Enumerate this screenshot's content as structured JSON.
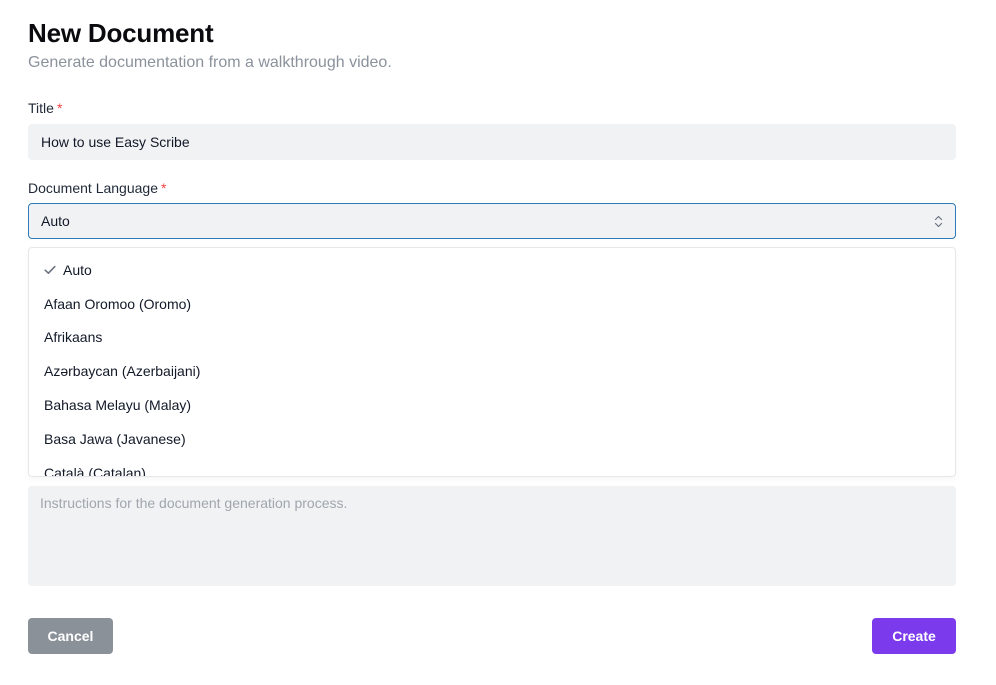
{
  "header": {
    "title": "New Document",
    "subtitle": "Generate documentation from a walkthrough video."
  },
  "form": {
    "title_field": {
      "label": "Title",
      "required_mark": "*",
      "value": "How to use Easy Scribe"
    },
    "language_field": {
      "label": "Document Language",
      "required_mark": "*",
      "selected": "Auto",
      "options": [
        "Auto",
        "Afaan Oromoo (Oromo)",
        "Afrikaans",
        "Azərbaycan (Azerbaijani)",
        "Bahasa Melayu (Malay)",
        "Basa Jawa (Javanese)",
        "Català (Catalan)"
      ]
    },
    "instructions_field": {
      "placeholder": "Instructions for the document generation process."
    }
  },
  "actions": {
    "cancel_label": "Cancel",
    "create_label": "Create"
  },
  "colors": {
    "accent": "#7c3aed",
    "required": "#ef4444",
    "focus_border": "#2f7ab8",
    "cancel_bg": "#8a9199"
  },
  "icons": {
    "select_arrows": "chevron-up-down-icon",
    "selected_check": "check-icon"
  }
}
